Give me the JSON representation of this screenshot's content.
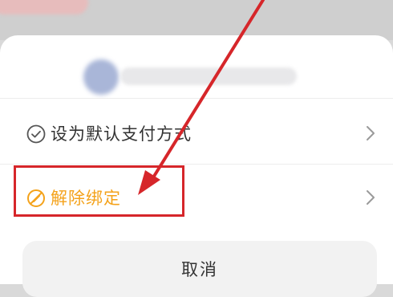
{
  "sheet": {
    "options": [
      {
        "label": "设为默认支付方式",
        "icon": "check-circle-icon"
      },
      {
        "label": "解除绑定",
        "icon": "unbind-icon"
      }
    ],
    "cancel_label": "取消"
  },
  "colors": {
    "warning": "#f4a21a",
    "annotation": "#d6262a",
    "text": "#333333"
  }
}
